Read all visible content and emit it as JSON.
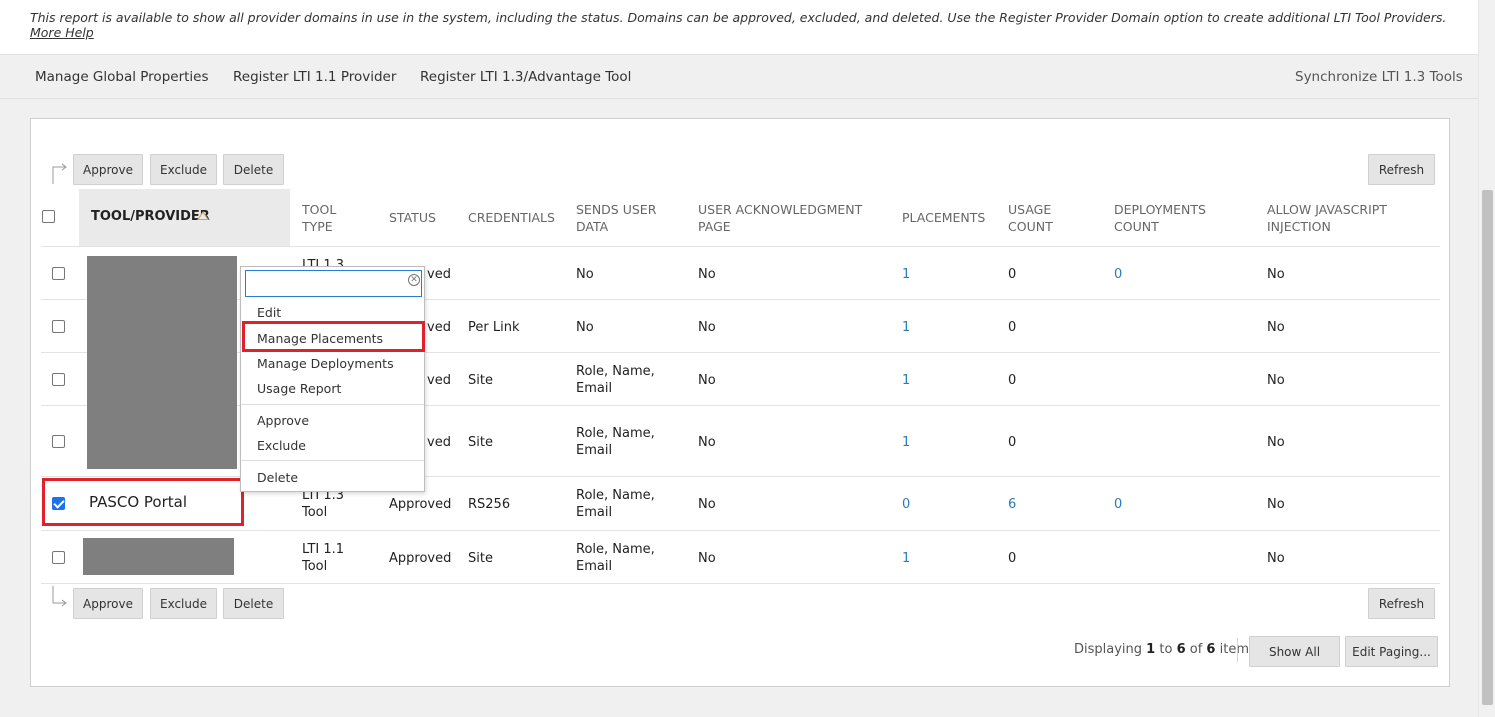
{
  "description": {
    "text": "This report is available to show all provider domains in use in the system, including the status. Domains can be approved, excluded, and deleted. Use the Register Provider Domain option to create additional LTI Tool Providers.",
    "help_link": "More Help"
  },
  "actionbar": {
    "manage_global": "Manage Global Properties",
    "register_11": "Register LTI 1.1 Provider",
    "register_13": "Register LTI 1.3/Advantage Tool",
    "synchronize": "Synchronize LTI 1.3 Tools"
  },
  "buttons": {
    "approve": "Approve",
    "exclude": "Exclude",
    "delete": "Delete",
    "refresh": "Refresh",
    "show_all": "Show All",
    "edit_paging": "Edit Paging..."
  },
  "columns": {
    "tool_provider": "TOOL/PROVIDER",
    "tool_type_1": "TOOL",
    "tool_type_2": "TYPE",
    "status": "STATUS",
    "credentials": "CREDENTIALS",
    "sends_1": "SENDS USER",
    "sends_2": "DATA",
    "ack_1": "USER ACKNOWLEDGMENT",
    "ack_2": "PAGE",
    "placements": "PLACEMENTS",
    "usage_1": "USAGE",
    "usage_2": "COUNT",
    "deploy_1": "DEPLOYMENTS",
    "deploy_2": "COUNT",
    "js_1": "ALLOW JAVASCRIPT",
    "js_2": "INJECTION"
  },
  "rows": [
    {
      "type1": "LTI 1.3",
      "type2": "",
      "status": "ved",
      "credentials": "",
      "sends1": "No",
      "sends2": "",
      "ack": "No",
      "placements": "1",
      "usage": "0",
      "deployments": "0",
      "js": "No"
    },
    {
      "type1": "",
      "type2": "",
      "status": "ved",
      "credentials": "Per Link",
      "sends1": "No",
      "sends2": "",
      "ack": "No",
      "placements": "1",
      "usage": "0",
      "deployments": "",
      "js": "No"
    },
    {
      "type1": "",
      "type2": "",
      "status": "ved",
      "credentials": "Site",
      "sends1": "Role, Name,",
      "sends2": "Email",
      "ack": "No",
      "placements": "1",
      "usage": "0",
      "deployments": "",
      "js": "No"
    },
    {
      "type1": "",
      "type2": "",
      "status": "ved",
      "credentials": "Site",
      "sends1": "Role, Name,",
      "sends2": "Email",
      "ack": "No",
      "placements": "1",
      "usage": "0",
      "deployments": "",
      "js": "No"
    },
    {
      "name": "PASCO Portal",
      "type1": "LTI 1.3",
      "type2": "Tool",
      "status": "Approved",
      "credentials": "RS256",
      "sends1": "Role, Name,",
      "sends2": "Email",
      "ack": "No",
      "placements": "0",
      "usage": "6",
      "deployments": "0",
      "js": "No"
    },
    {
      "type1": "LTI 1.1",
      "type2": "Tool",
      "status": "Approved",
      "credentials": "Site",
      "sends1": "Role, Name,",
      "sends2": "Email",
      "ack": "No",
      "placements": "1",
      "usage": "0",
      "deployments": "",
      "js": "No"
    }
  ],
  "menu": {
    "filter_value": "",
    "edit": "Edit",
    "manage_placements": "Manage Placements",
    "manage_deployments": "Manage Deployments",
    "usage_report": "Usage Report",
    "approve": "Approve",
    "exclude": "Exclude",
    "delete": "Delete"
  },
  "paging": {
    "prefix": "Displaying",
    "from": "1",
    "to_word": "to",
    "to": "6",
    "of_word": "of",
    "total": "6",
    "suffix": "items"
  },
  "colors": {
    "link": "#2c7bb6",
    "highlight": "#e0202a",
    "redaction": "#7f7f7f"
  }
}
